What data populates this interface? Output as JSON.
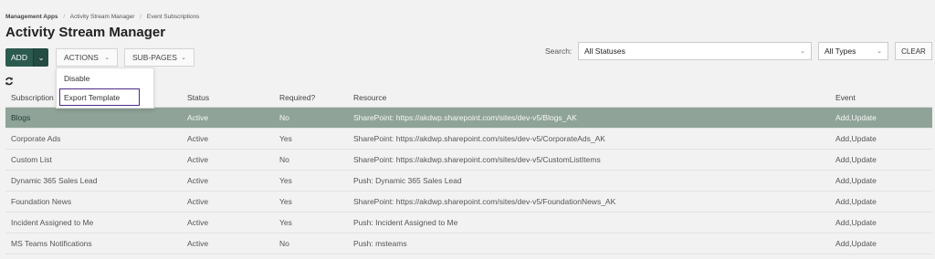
{
  "breadcrumb": {
    "items": [
      "Management Apps",
      "Activity Stream Manager",
      "Event Subscriptions"
    ],
    "separator": "/"
  },
  "page": {
    "title": "Activity Stream Manager"
  },
  "toolbar": {
    "add_label": "ADD",
    "actions_label": "ACTIONS",
    "subpages_label": "SUB-PAGES",
    "caret": "⌄",
    "chevron": "⌄"
  },
  "actions_menu": {
    "items": [
      "Disable",
      "Export Template"
    ]
  },
  "filters": {
    "search_label": "Search:",
    "status_value": "All Statuses",
    "type_value": "All Types",
    "clear_label": "CLEAR"
  },
  "table": {
    "columns": [
      "Subscription",
      "Status",
      "Required?",
      "Resource",
      "Event"
    ],
    "rows": [
      {
        "name": "Blogs",
        "status": "Active",
        "required": "No",
        "resource": "SharePoint: https://akdwp.sharepoint.com/sites/dev-v5/Blogs_AK",
        "event": "Add,Update",
        "selected": true
      },
      {
        "name": "Corporate Ads",
        "status": "Active",
        "required": "Yes",
        "resource": "SharePoint: https://akdwp.sharepoint.com/sites/dev-v5/CorporateAds_AK",
        "event": "Add,Update",
        "selected": false
      },
      {
        "name": "Custom List",
        "status": "Active",
        "required": "No",
        "resource": "SharePoint: https://akdwp.sharepoint.com/sites/dev-v5/CustomListItems",
        "event": "Add,Update",
        "selected": false
      },
      {
        "name": "Dynamic 365 Sales Lead",
        "status": "Active",
        "required": "Yes",
        "resource": "Push: Dynamic 365 Sales Lead",
        "event": "Add,Update",
        "selected": false
      },
      {
        "name": "Foundation News",
        "status": "Active",
        "required": "Yes",
        "resource": "SharePoint: https://akdwp.sharepoint.com/sites/dev-v5/FoundationNews_AK",
        "event": "Add,Update",
        "selected": false
      },
      {
        "name": "Incident Assigned to Me",
        "status": "Active",
        "required": "Yes",
        "resource": "Push: Incident Assigned to Me",
        "event": "Add,Update",
        "selected": false
      },
      {
        "name": "MS Teams Notifications",
        "status": "Active",
        "required": "No",
        "resource": "Push: msteams",
        "event": "Add,Update",
        "selected": false
      }
    ]
  },
  "colors": {
    "primary": "#2c5a4f",
    "selected_row": "#8fa398",
    "menu_highlight_border": "#4b2a8a",
    "background": "#f2f2f2"
  }
}
